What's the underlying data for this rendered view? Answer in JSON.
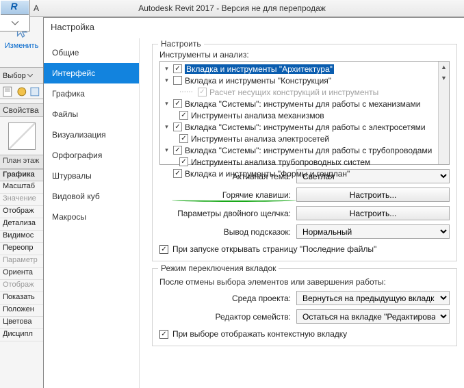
{
  "titlebar": {
    "title": "Autodesk Revit 2017 - Версия не для перепродаж"
  },
  "modify": {
    "label": "Изменить"
  },
  "selector": {
    "label": "Выбор"
  },
  "props": {
    "header": "Свойства",
    "category": "План этаж",
    "group_graphics": "Графика",
    "rows": [
      {
        "label": "Масштаб",
        "gray": false
      },
      {
        "label": "Значение",
        "gray": true
      },
      {
        "label": "Отображ",
        "gray": false
      },
      {
        "label": "Детализа",
        "gray": false
      },
      {
        "label": "Видимос",
        "gray": false
      },
      {
        "label": "Переопр",
        "gray": false
      },
      {
        "label": "Параметр",
        "gray": true
      },
      {
        "label": "Ориента",
        "gray": false
      },
      {
        "label": "Отображ",
        "gray": true
      },
      {
        "label": "Показать",
        "gray": false
      },
      {
        "label": "Положен",
        "gray": false
      },
      {
        "label": "Цветова",
        "gray": false
      },
      {
        "label": "Дисципл",
        "gray": false
      }
    ]
  },
  "dialog": {
    "title": "Настройка",
    "sidebar": [
      {
        "key": "general",
        "label": "Общие"
      },
      {
        "key": "interface",
        "label": "Интерфейс",
        "active": true
      },
      {
        "key": "graphics",
        "label": "Графика"
      },
      {
        "key": "files",
        "label": "Файлы"
      },
      {
        "key": "vis",
        "label": "Визуализация"
      },
      {
        "key": "spell",
        "label": "Орфография"
      },
      {
        "key": "wheels",
        "label": "Штурвалы"
      },
      {
        "key": "viewcube",
        "label": "Видовой куб"
      },
      {
        "key": "macros",
        "label": "Макросы"
      }
    ],
    "configure": {
      "group_label": "Настроить",
      "tools_label": "Инструменты и анализ:",
      "tree": [
        {
          "level": 0,
          "exp": "-",
          "checked": true,
          "label": "Вкладка и инструменты \"Архитектура\"",
          "selected": true
        },
        {
          "level": 0,
          "exp": "-",
          "checked": false,
          "label": "Вкладка и инструменты \"Конструкция\""
        },
        {
          "level": 1,
          "exp": "",
          "checked": true,
          "label": "Расчет несущих конструкций и инструменты",
          "disabled": true,
          "line": true
        },
        {
          "level": 0,
          "exp": "-",
          "checked": true,
          "label": "Вкладка \"Системы\": инструменты для работы с механизмами"
        },
        {
          "level": 1,
          "exp": "",
          "checked": true,
          "label": "Инструменты анализа механизмов"
        },
        {
          "level": 0,
          "exp": "-",
          "checked": true,
          "label": "Вкладка \"Системы\": инструменты для работы с электросетями"
        },
        {
          "level": 1,
          "exp": "",
          "checked": true,
          "label": "Инструменты анализа электросетей"
        },
        {
          "level": 0,
          "exp": "-",
          "checked": true,
          "label": "Вкладка \"Системы\": инструменты для работы с трубопроводами"
        },
        {
          "level": 1,
          "exp": "",
          "checked": true,
          "label": "Инструменты анализа трубопроводных систем"
        },
        {
          "level": 0,
          "exp": "",
          "checked": true,
          "label": "Вкладка и инструменты \"Формы и генплан\""
        }
      ],
      "active_theme_label": "Активная тема:",
      "active_theme_value": "Светлая",
      "shortcuts_label": "Горячие клавиши:",
      "shortcuts_button": "Настроить...",
      "dblclick_label": "Параметры двойного щелчка:",
      "dblclick_button": "Настроить...",
      "tooltip_label": "Вывод подсказок:",
      "tooltip_value": "Нормальный",
      "startup_check": "При запуске открывать страницу \"Последние файлы\""
    },
    "tab_switch": {
      "group_label": "Режим переключения вкладок",
      "sub_label": "После отмены выбора элементов или завершения работы:",
      "env_label": "Среда проекта:",
      "env_value": "Вернуться на предыдущую вкладк",
      "family_label": "Редактор семейств:",
      "family_value": "Остаться на вкладке \"Редактирова",
      "context_check": "При выборе отображать контекстную вкладку"
    }
  }
}
